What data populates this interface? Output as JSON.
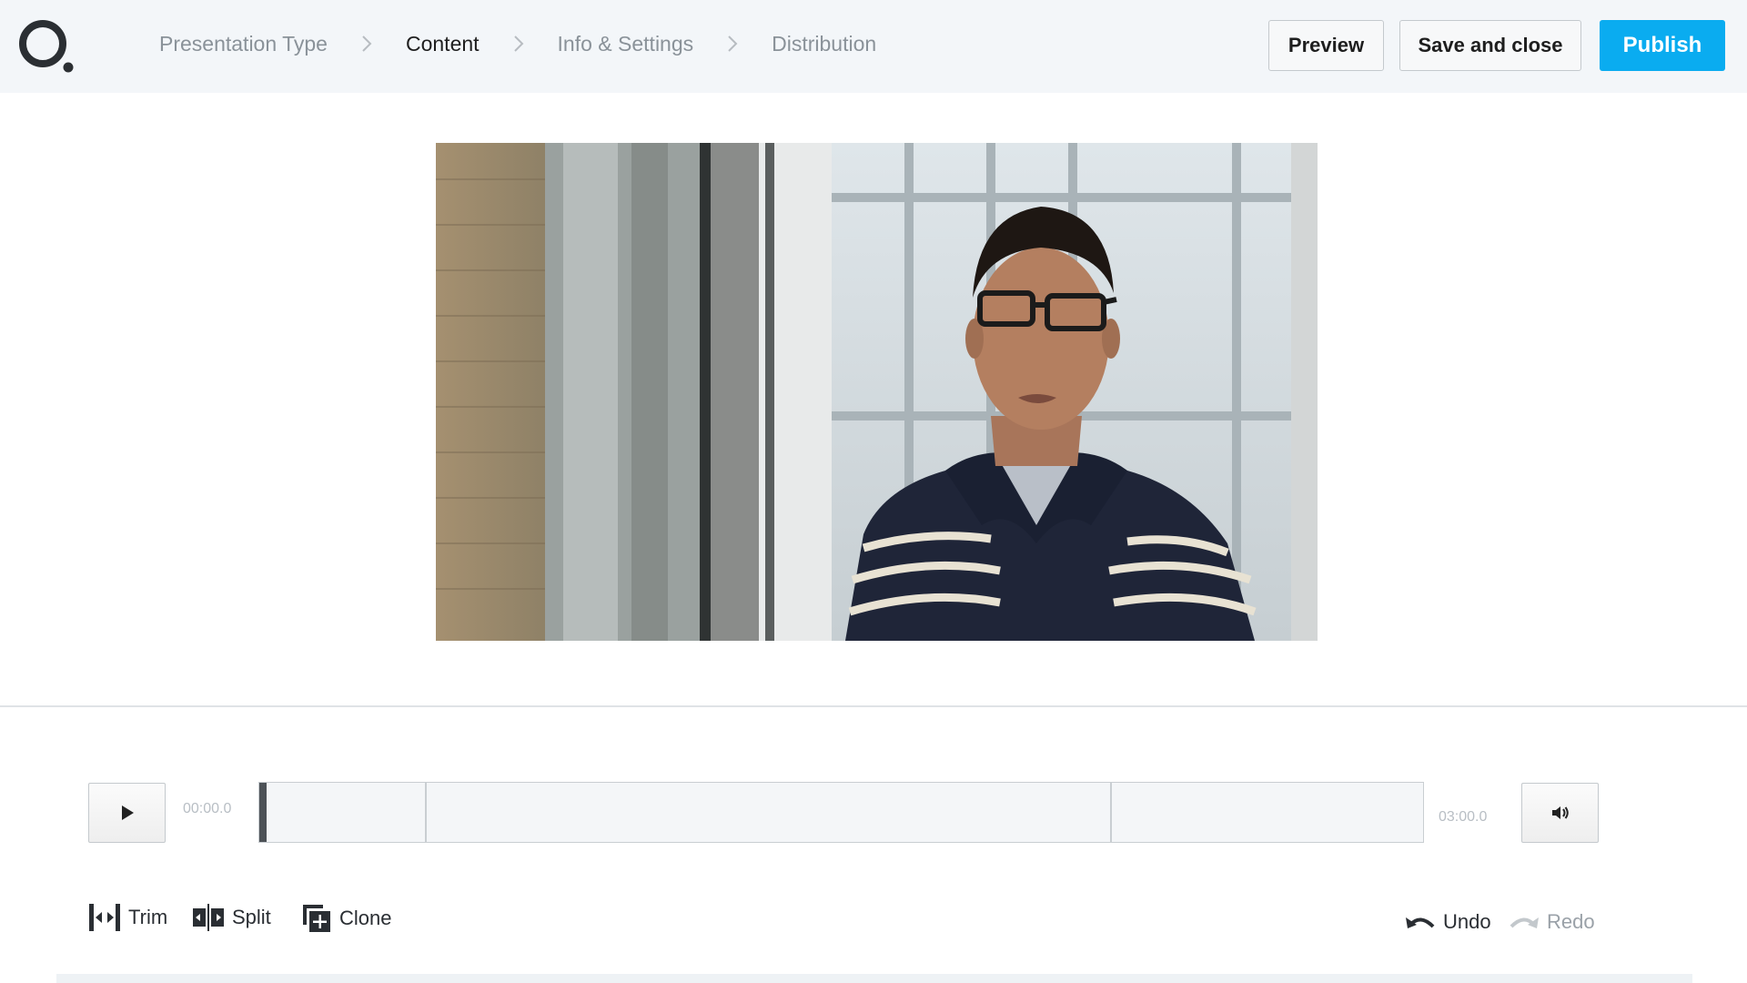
{
  "header": {
    "steps": [
      {
        "label": "Presentation Type",
        "active": false
      },
      {
        "label": "Content",
        "active": true
      },
      {
        "label": "Info & Settings",
        "active": false
      },
      {
        "label": "Distribution",
        "active": false
      }
    ],
    "preview_label": "Preview",
    "save_label": "Save and close",
    "publish_label": "Publish"
  },
  "player": {
    "current_time": "00:00.0",
    "duration": "03:00.0"
  },
  "tools": {
    "trim_label": "Trim",
    "split_label": "Split",
    "clone_label": "Clone",
    "undo_label": "Undo",
    "redo_label": "Redo"
  },
  "colors": {
    "accent": "#0aacf0",
    "header_bg": "#f3f6f9"
  },
  "icons": [
    "logo-icon",
    "chevron-right-icon",
    "play-icon",
    "volume-icon",
    "trim-icon",
    "split-icon",
    "clone-icon",
    "undo-icon",
    "redo-icon"
  ]
}
